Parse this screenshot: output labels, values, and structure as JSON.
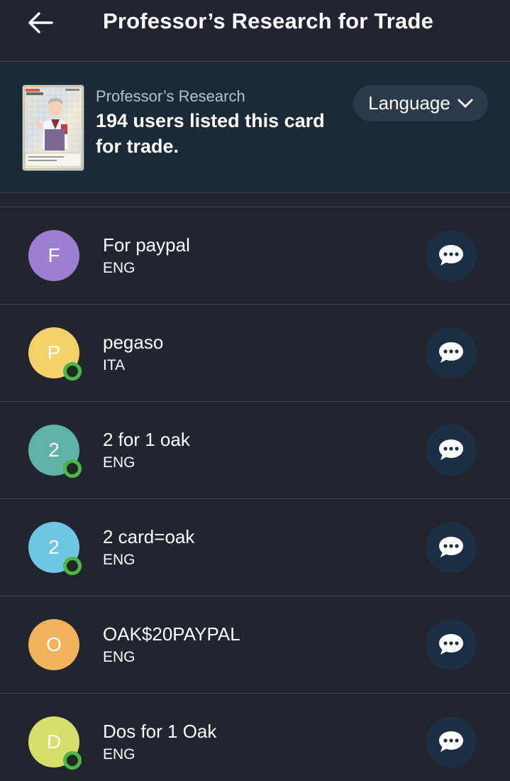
{
  "appbar": {
    "title": "Professor’s Research for Trade",
    "back_icon": "arrow-left-icon"
  },
  "card": {
    "name": "Professor’s Research",
    "summary": "194 users listed this card for trade.",
    "language_button": "Language",
    "language_icon": "chevron-down-icon"
  },
  "colors": {
    "background": "#23252e",
    "header_background": "#1b2a38",
    "chat_button": "#1b2f44",
    "online": "#4cb648"
  },
  "listings": [
    {
      "initial": "F",
      "name": "For paypal",
      "language": "ENG",
      "avatar_color": "#9b7fd0",
      "online": false
    },
    {
      "initial": "P",
      "name": "pegaso",
      "language": "ITA",
      "avatar_color": "#f3d26a",
      "online": true
    },
    {
      "initial": "2",
      "name": "2 for 1 oak",
      "language": "ENG",
      "avatar_color": "#5fb3a6",
      "online": true
    },
    {
      "initial": "2",
      "name": "2 card=oak",
      "language": "ENG",
      "avatar_color": "#6ec6e4",
      "online": true
    },
    {
      "initial": "O",
      "name": "OAK$20PAYPAL",
      "language": "ENG",
      "avatar_color": "#f1b35c",
      "online": false
    },
    {
      "initial": "D",
      "name": "Dos for 1 Oak",
      "language": "ENG",
      "avatar_color": "#d5e06b",
      "online": true
    }
  ]
}
